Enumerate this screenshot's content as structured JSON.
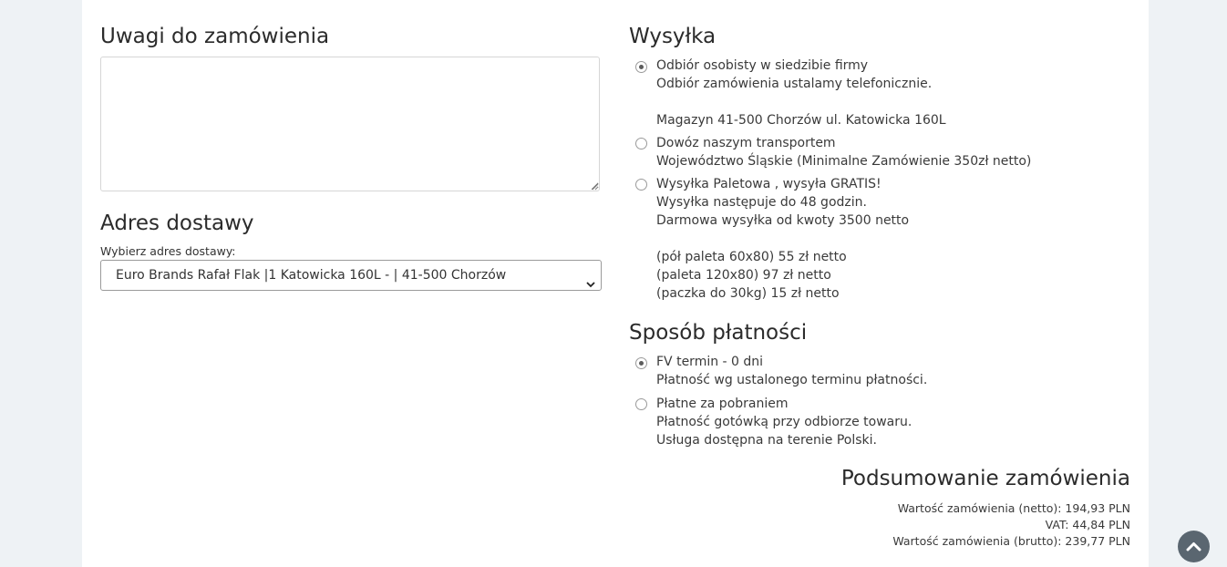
{
  "notes": {
    "heading": "Uwagi do zamówienia",
    "value": ""
  },
  "address": {
    "heading": "Adres dostawy",
    "label": "Wybierz adres dostawy:",
    "selected": "Euro Brands Rafał Flak |1 Katowicka 160L - | 41-500 Chorzów"
  },
  "shipping": {
    "heading": "Wysyłka",
    "options": [
      {
        "title": "Odbiór osobisty w siedzibie firmy",
        "checked": true,
        "lines": [
          "Odbiór zamówienia ustalamy telefonicznie.",
          "",
          "Magazyn 41-500 Chorzów ul. Katowicka 160L"
        ]
      },
      {
        "title": "Dowóz naszym transportem",
        "checked": false,
        "lines": [
          "Województwo Śląskie (Minimalne Zamówienie 350zł netto)"
        ]
      },
      {
        "title": "Wysyłka Paletowa , wysyła GRATIS!",
        "checked": false,
        "lines": [
          "Wysyłka następuje do 48 godzin.",
          "Darmowa wysyłka od kwoty 3500 netto",
          "",
          "(pół paleta 60x80) 55 zł netto",
          "(paleta 120x80) 97 zł netto",
          "(paczka do 30kg) 15 zł netto"
        ]
      }
    ]
  },
  "payment": {
    "heading": "Sposób płatności",
    "options": [
      {
        "title": "FV termin - 0 dni",
        "checked": true,
        "lines": [
          "Płatność wg ustalonego terminu płatności."
        ]
      },
      {
        "title": "Płatne za pobraniem",
        "checked": false,
        "lines": [
          "Płatność gotówką przy odbiorze towaru.",
          "Usługa dostępna na terenie Polski."
        ]
      }
    ]
  },
  "summary": {
    "heading": "Podsumowanie zamówienia",
    "net": "Wartość zamówienia (netto): 194,93 PLN",
    "vat": "VAT: 44,84 PLN",
    "gross": "Wartość zamówienia (brutto): 239,77 PLN"
  },
  "icons": {
    "scroll_top": "chevron-up-icon",
    "select_arrow": "chevron-down-icon"
  }
}
